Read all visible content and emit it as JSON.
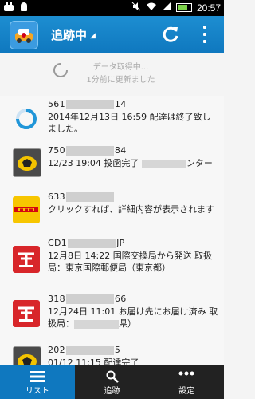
{
  "status_bar": {
    "time": "20:57"
  },
  "action_bar": {
    "title": "追跡中",
    "refresh_icon": "refresh-icon",
    "overflow_icon": "overflow-menu-icon"
  },
  "loader": {
    "line1": "データ取得中...",
    "line2": "1分前に更新ました"
  },
  "items": [
    {
      "carrier_icon": "progress-spinner-icon",
      "number_prefix": "561",
      "number_suffix": "14",
      "desc": "2014年12月13日 16:59 配達は終了致しました。"
    },
    {
      "carrier_icon": "yamato-logo-icon",
      "number_prefix": "750",
      "number_suffix": "84",
      "desc_a": "12/23 19:04 投函完了",
      "desc_b": "ンター"
    },
    {
      "carrier_icon": "dhl-logo-icon",
      "number_prefix": "633",
      "number_suffix": "",
      "desc": "クリックすれば、詳細内容が表示されます"
    },
    {
      "carrier_icon": "japan-post-logo-icon",
      "number_prefix": "CD1",
      "number_suffix": "JP",
      "desc": "12月8日 14:22 国際交換局から発送 取扱局：東京国際郵便局（東京都）"
    },
    {
      "carrier_icon": "japan-post-logo-icon",
      "number_prefix": "318",
      "number_suffix": "66",
      "desc_a": "12月24日 11:01 お届け先にお届け済み 取扱局：",
      "desc_b": "県）"
    },
    {
      "carrier_icon": "yamato-logo-icon",
      "number_prefix": "202",
      "number_suffix": "5",
      "desc": "01/12 11:15 配達完了"
    }
  ],
  "bottom_nav": [
    {
      "label": "リスト",
      "icon": "list-icon",
      "active": true
    },
    {
      "label": "追跡",
      "icon": "search-icon",
      "active": false
    },
    {
      "label": "設定",
      "icon": "more-icon",
      "active": false
    }
  ],
  "colors": {
    "accent": "#0f78bf",
    "dhl": "#f7c600",
    "japan_post": "#d8262a"
  }
}
